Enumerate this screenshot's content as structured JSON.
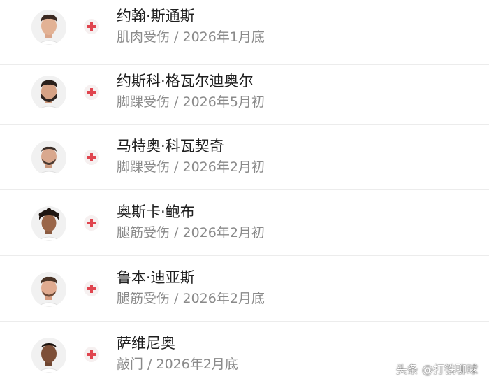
{
  "players": [
    {
      "name": "约翰·斯通斯",
      "status": "肌肉受伤 / 2026年1月底",
      "icon": "player-avatar"
    },
    {
      "name": "约斯科·格瓦尔迪奥尔",
      "status": "脚踝受伤 / 2026年5月初",
      "icon": "player-avatar"
    },
    {
      "name": "马特奥·科瓦契奇",
      "status": "脚踝受伤 / 2026年2月初",
      "icon": "player-avatar"
    },
    {
      "name": "奥斯卡·鲍布",
      "status": "腿筋受伤 / 2026年2月初",
      "icon": "player-avatar"
    },
    {
      "name": "鲁本·迪亚斯",
      "status": "腿筋受伤 / 2026年2月底",
      "icon": "player-avatar"
    },
    {
      "name": "萨维尼奥",
      "status": "敲门 / 2026年2月底",
      "icon": "player-avatar"
    }
  ],
  "injury_icon": "medical-cross-icon",
  "colors": {
    "injury_red": "#e0454f",
    "name_text": "#1f1f1f",
    "status_text": "#8a8a8a",
    "divider": "#ececec"
  },
  "watermark": "头条 @打铁聊球"
}
